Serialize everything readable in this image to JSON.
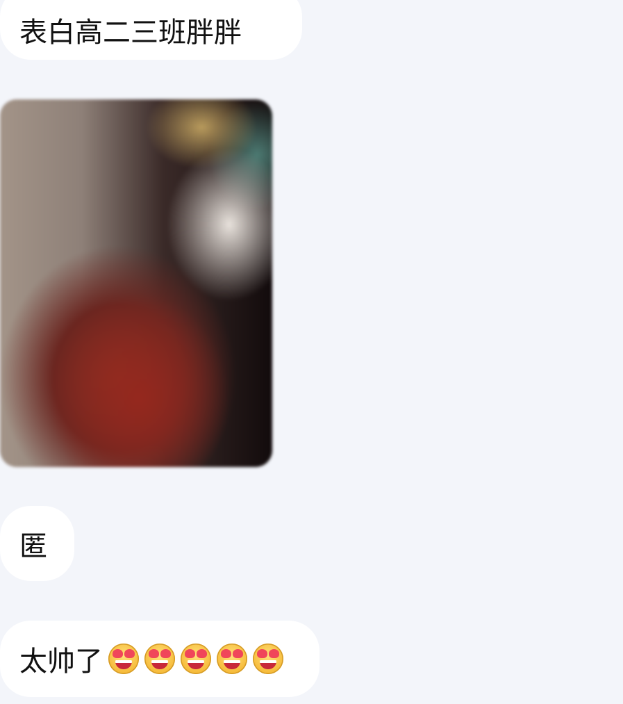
{
  "messages": [
    {
      "type": "text",
      "text": "表白高二三班胖胖"
    },
    {
      "type": "image"
    },
    {
      "type": "text",
      "text": "匿"
    },
    {
      "type": "text",
      "text": "太帅了",
      "emoji": [
        "heart-eyes-emoji",
        "heart-eyes-emoji",
        "heart-eyes-emoji",
        "heart-eyes-emoji",
        "heart-eyes-emoji"
      ]
    }
  ],
  "colors": {
    "background": "#f3f5fa",
    "bubble": "#ffffff",
    "text": "#111111"
  }
}
